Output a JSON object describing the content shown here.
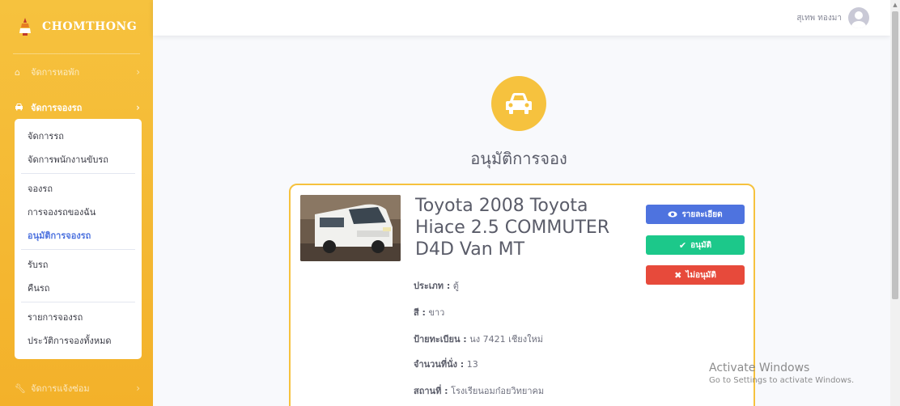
{
  "brand": {
    "title": "CHOMTHONG",
    "logo_icon": "temple-logo-icon"
  },
  "sidebar": {
    "sections": [
      {
        "label": "จัดการหอพัก",
        "icon": "house-icon"
      },
      {
        "label": "จัดการจองรถ",
        "icon": "car-icon"
      }
    ],
    "submenu": [
      {
        "label": "จัดการรถ"
      },
      {
        "label": "จัดการพนักงานขับรถ"
      },
      {
        "label": "จองรถ"
      },
      {
        "label": "การจองรถของฉัน"
      },
      {
        "label": "อนุมัติการจองรถ"
      },
      {
        "label": "รับรถ"
      },
      {
        "label": "คืนรถ"
      },
      {
        "label": "รายการจองรถ"
      },
      {
        "label": "ประวัติการจองทั้งหมด"
      }
    ],
    "repair": {
      "label": "จัดการแจ้งซ่อม",
      "icon": "wrench-icon"
    }
  },
  "topbar": {
    "user_name": "สุเทพ ทองมา"
  },
  "page": {
    "title": "อนุมัติการจอง",
    "header_icon": "car-icon"
  },
  "booking": {
    "car_name": "Toyota 2008 Toyota Hiace 2.5 COMMUTER D4D Van MT",
    "details": [
      {
        "label": "ประเภท :",
        "value": "ตู้"
      },
      {
        "label": "สี :",
        "value": "ขาว"
      },
      {
        "label": "ป้ายทะเบียน :",
        "value": "นง 7421 เชียงใหม่"
      },
      {
        "label": "จำนวนที่นั่ง :",
        "value": "13"
      },
      {
        "label": "สถานที่ :",
        "value": "โรงเรียนอมก๋อยวิทยาคม"
      }
    ],
    "buttons": {
      "detail": "รายละเอียด",
      "approve": "อนุมัติ",
      "reject": "ไม่อนุมัติ"
    }
  },
  "watermark": {
    "title": "Activate Windows",
    "subtitle": "Go to Settings to activate Windows."
  },
  "colors": {
    "sidebar": "#f6c23e",
    "primary": "#4e73df",
    "success": "#1cc88a",
    "danger": "#e74a3b",
    "card_border": "#f6c23e"
  }
}
